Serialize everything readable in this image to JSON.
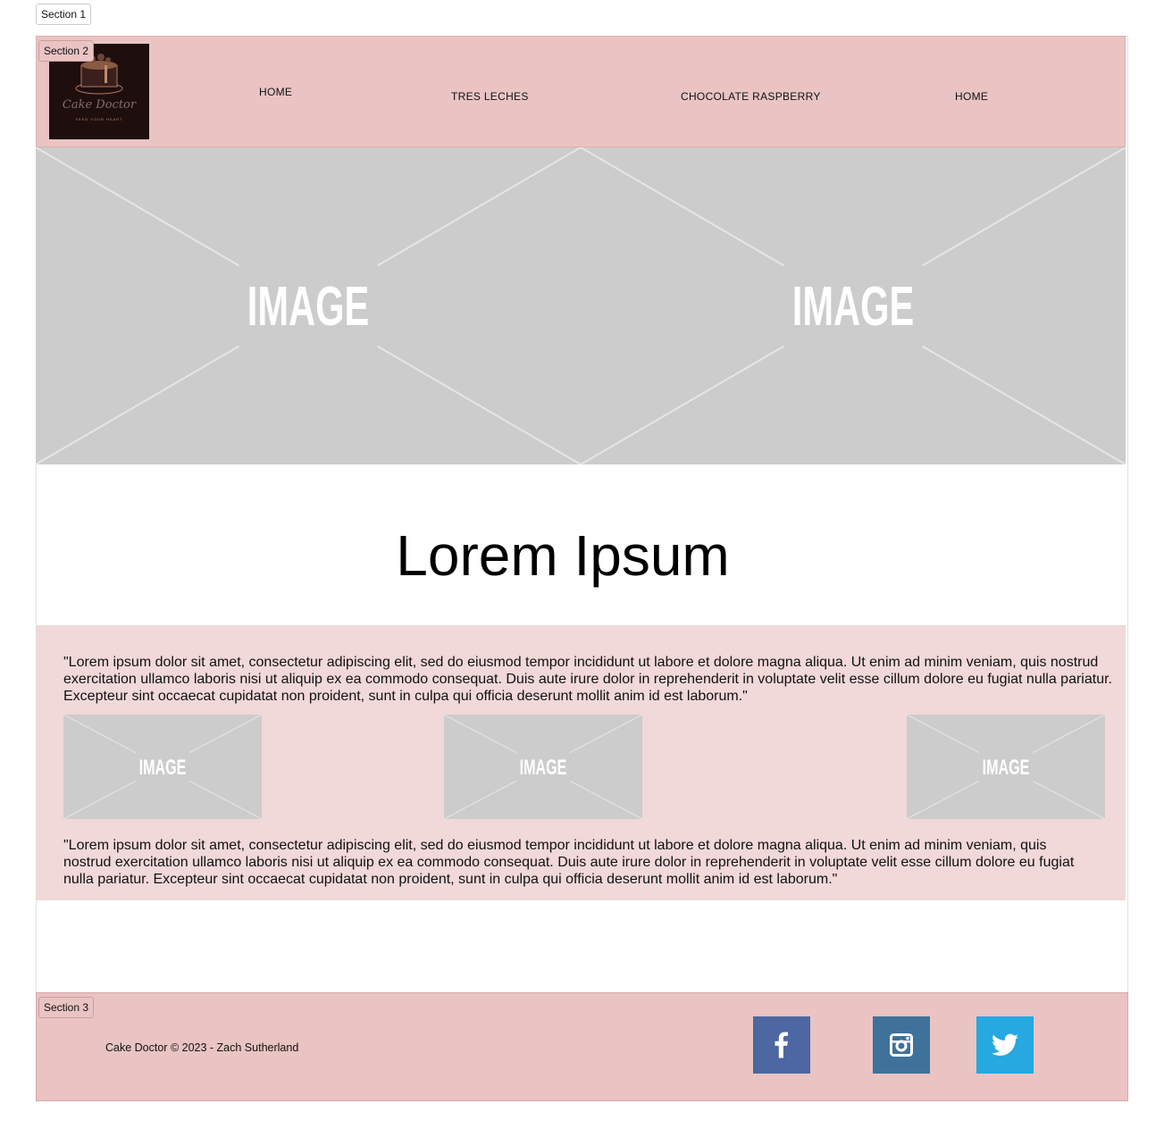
{
  "sections": {
    "s1": "Section 1",
    "s2": "Section 2",
    "s3": "Section 3"
  },
  "logo": {
    "brand": "Cake Doctor",
    "tagline": "FEED YOUR HEART",
    "est_left": "ES TD",
    "est_right": "20 23"
  },
  "nav": [
    "HOME",
    "TRES LECHES",
    "CHOCOLATE RASPBERRY",
    "HOME"
  ],
  "placeholder_label": "IMAGE",
  "heading": "Lorem Ipsum",
  "paragraphs": [
    "\"Lorem ipsum dolor sit amet, consectetur adipiscing elit, sed do eiusmod tempor incididunt ut labore et dolore magna aliqua. Ut enim ad minim veniam, quis nostrud exercitation ullamco laboris nisi ut aliquip ex ea commodo consequat. Duis aute irure dolor in reprehenderit in voluptate velit esse cillum dolore eu fugiat nulla pariatur. Excepteur sint occaecat cupidatat non proident, sunt in culpa qui officia deserunt mollit anim id est laborum.\"",
    "\"Lorem ipsum dolor sit amet, consectetur adipiscing elit, sed do eiusmod tempor incididunt ut labore et dolore magna aliqua. Ut enim ad minim veniam, quis nostrud exercitation ullamco laboris nisi ut aliquip ex ea commodo consequat. Duis aute irure dolor in reprehenderit in voluptate velit esse cillum dolore eu fugiat nulla pariatur. Excepteur sint occaecat cupidatat non proident, sunt in culpa qui officia deserunt mollit anim id est laborum.\""
  ],
  "footer": {
    "copyright": "Cake Doctor © 2023 - Zach Sutherland"
  },
  "social": [
    {
      "icon": "facebook-icon",
      "color": "#4c67a1"
    },
    {
      "icon": "instagram-icon",
      "color": "#3f729b"
    },
    {
      "icon": "twitter-icon",
      "color": "#26a8e0"
    }
  ],
  "colors": {
    "header_bg": "#eac3c3",
    "content_bg": "#f1d8d9",
    "placeholder": "#cccccc"
  }
}
